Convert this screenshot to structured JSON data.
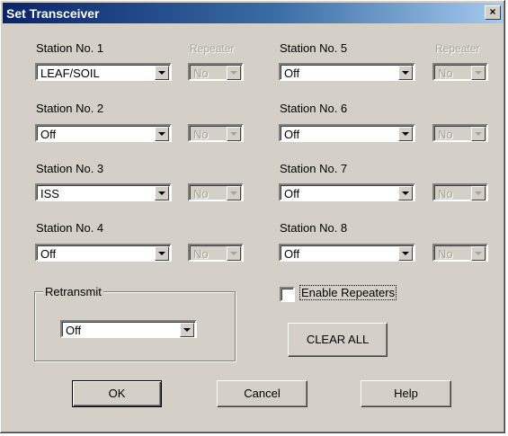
{
  "window": {
    "title": "Set Transceiver",
    "close_glyph": "×"
  },
  "stations": [
    {
      "label": "Station No. 1",
      "value": "LEAF/SOIL",
      "repeater_label": "Repeater",
      "repeater_value": "No"
    },
    {
      "label": "Station No. 2",
      "value": "Off",
      "repeater_value": "No"
    },
    {
      "label": "Station No. 3",
      "value": "ISS",
      "repeater_value": "No"
    },
    {
      "label": "Station No. 4",
      "value": "Off",
      "repeater_value": "No"
    },
    {
      "label": "Station No. 5",
      "value": "Off",
      "repeater_label": "Repeater",
      "repeater_value": "No"
    },
    {
      "label": "Station No. 6",
      "value": "Off",
      "repeater_value": "No"
    },
    {
      "label": "Station No. 7",
      "value": "Off",
      "repeater_value": "No"
    },
    {
      "label": "Station No. 8",
      "value": "Off",
      "repeater_value": "No"
    }
  ],
  "retransmit": {
    "label": "Retransmit",
    "value": "Off"
  },
  "enable_repeaters": {
    "label": "Enable Repeaters",
    "checked": false
  },
  "buttons": {
    "clear_all": "CLEAR ALL",
    "ok": "OK",
    "cancel": "Cancel",
    "help": "Help"
  }
}
